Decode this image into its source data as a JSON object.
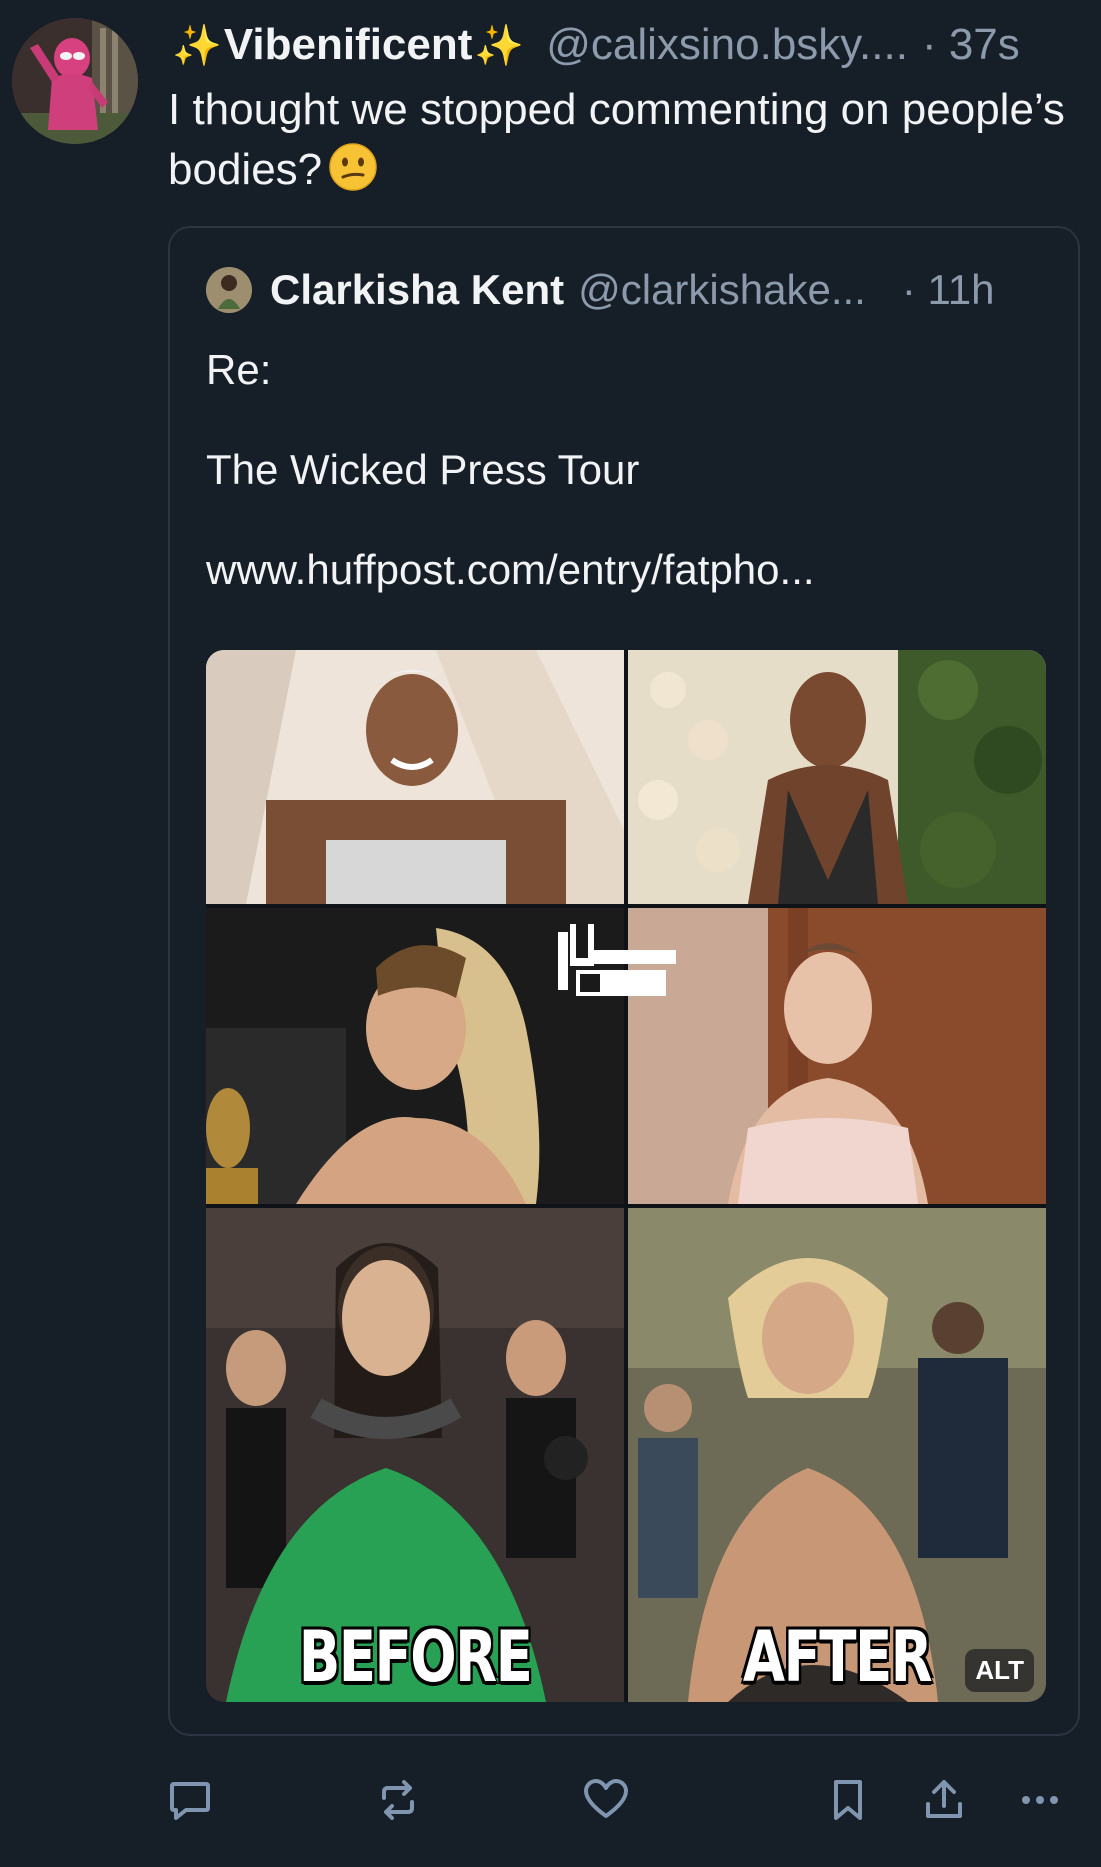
{
  "post": {
    "author": {
      "display_name": "Vibenificent",
      "sparkle_left": "✨",
      "sparkle_right": "✨",
      "handle": "@calixsino.bsky....",
      "avatar": "avatar"
    },
    "time": "· 37s",
    "text": "I thought we stopped commenting on people’s bodies?",
    "emoji": "confused-face-emoji"
  },
  "quote": {
    "author": {
      "display_name": "Clarkisha Kent",
      "handle": "@clarkishake...",
      "avatar": "avatar"
    },
    "time": "· 11h",
    "lines": [
      "Re:",
      "The Wicked Press Tour",
      "www.huffpost.com/entry/fatpho..."
    ],
    "image": {
      "caption_before": "BEFORE",
      "caption_after": "AFTER",
      "alt_badge": "ALT"
    }
  },
  "actions": {
    "reply": "reply-icon",
    "repost": "repost-icon",
    "like": "heart-icon",
    "bookmark": "bookmark-icon",
    "share": "share-icon",
    "more": "more-icon"
  },
  "colors": {
    "background": "#161e27",
    "text": "#f1f3f5",
    "muted": "#8c9aab",
    "border": "#2b3542",
    "icon": "#7f95b0"
  }
}
